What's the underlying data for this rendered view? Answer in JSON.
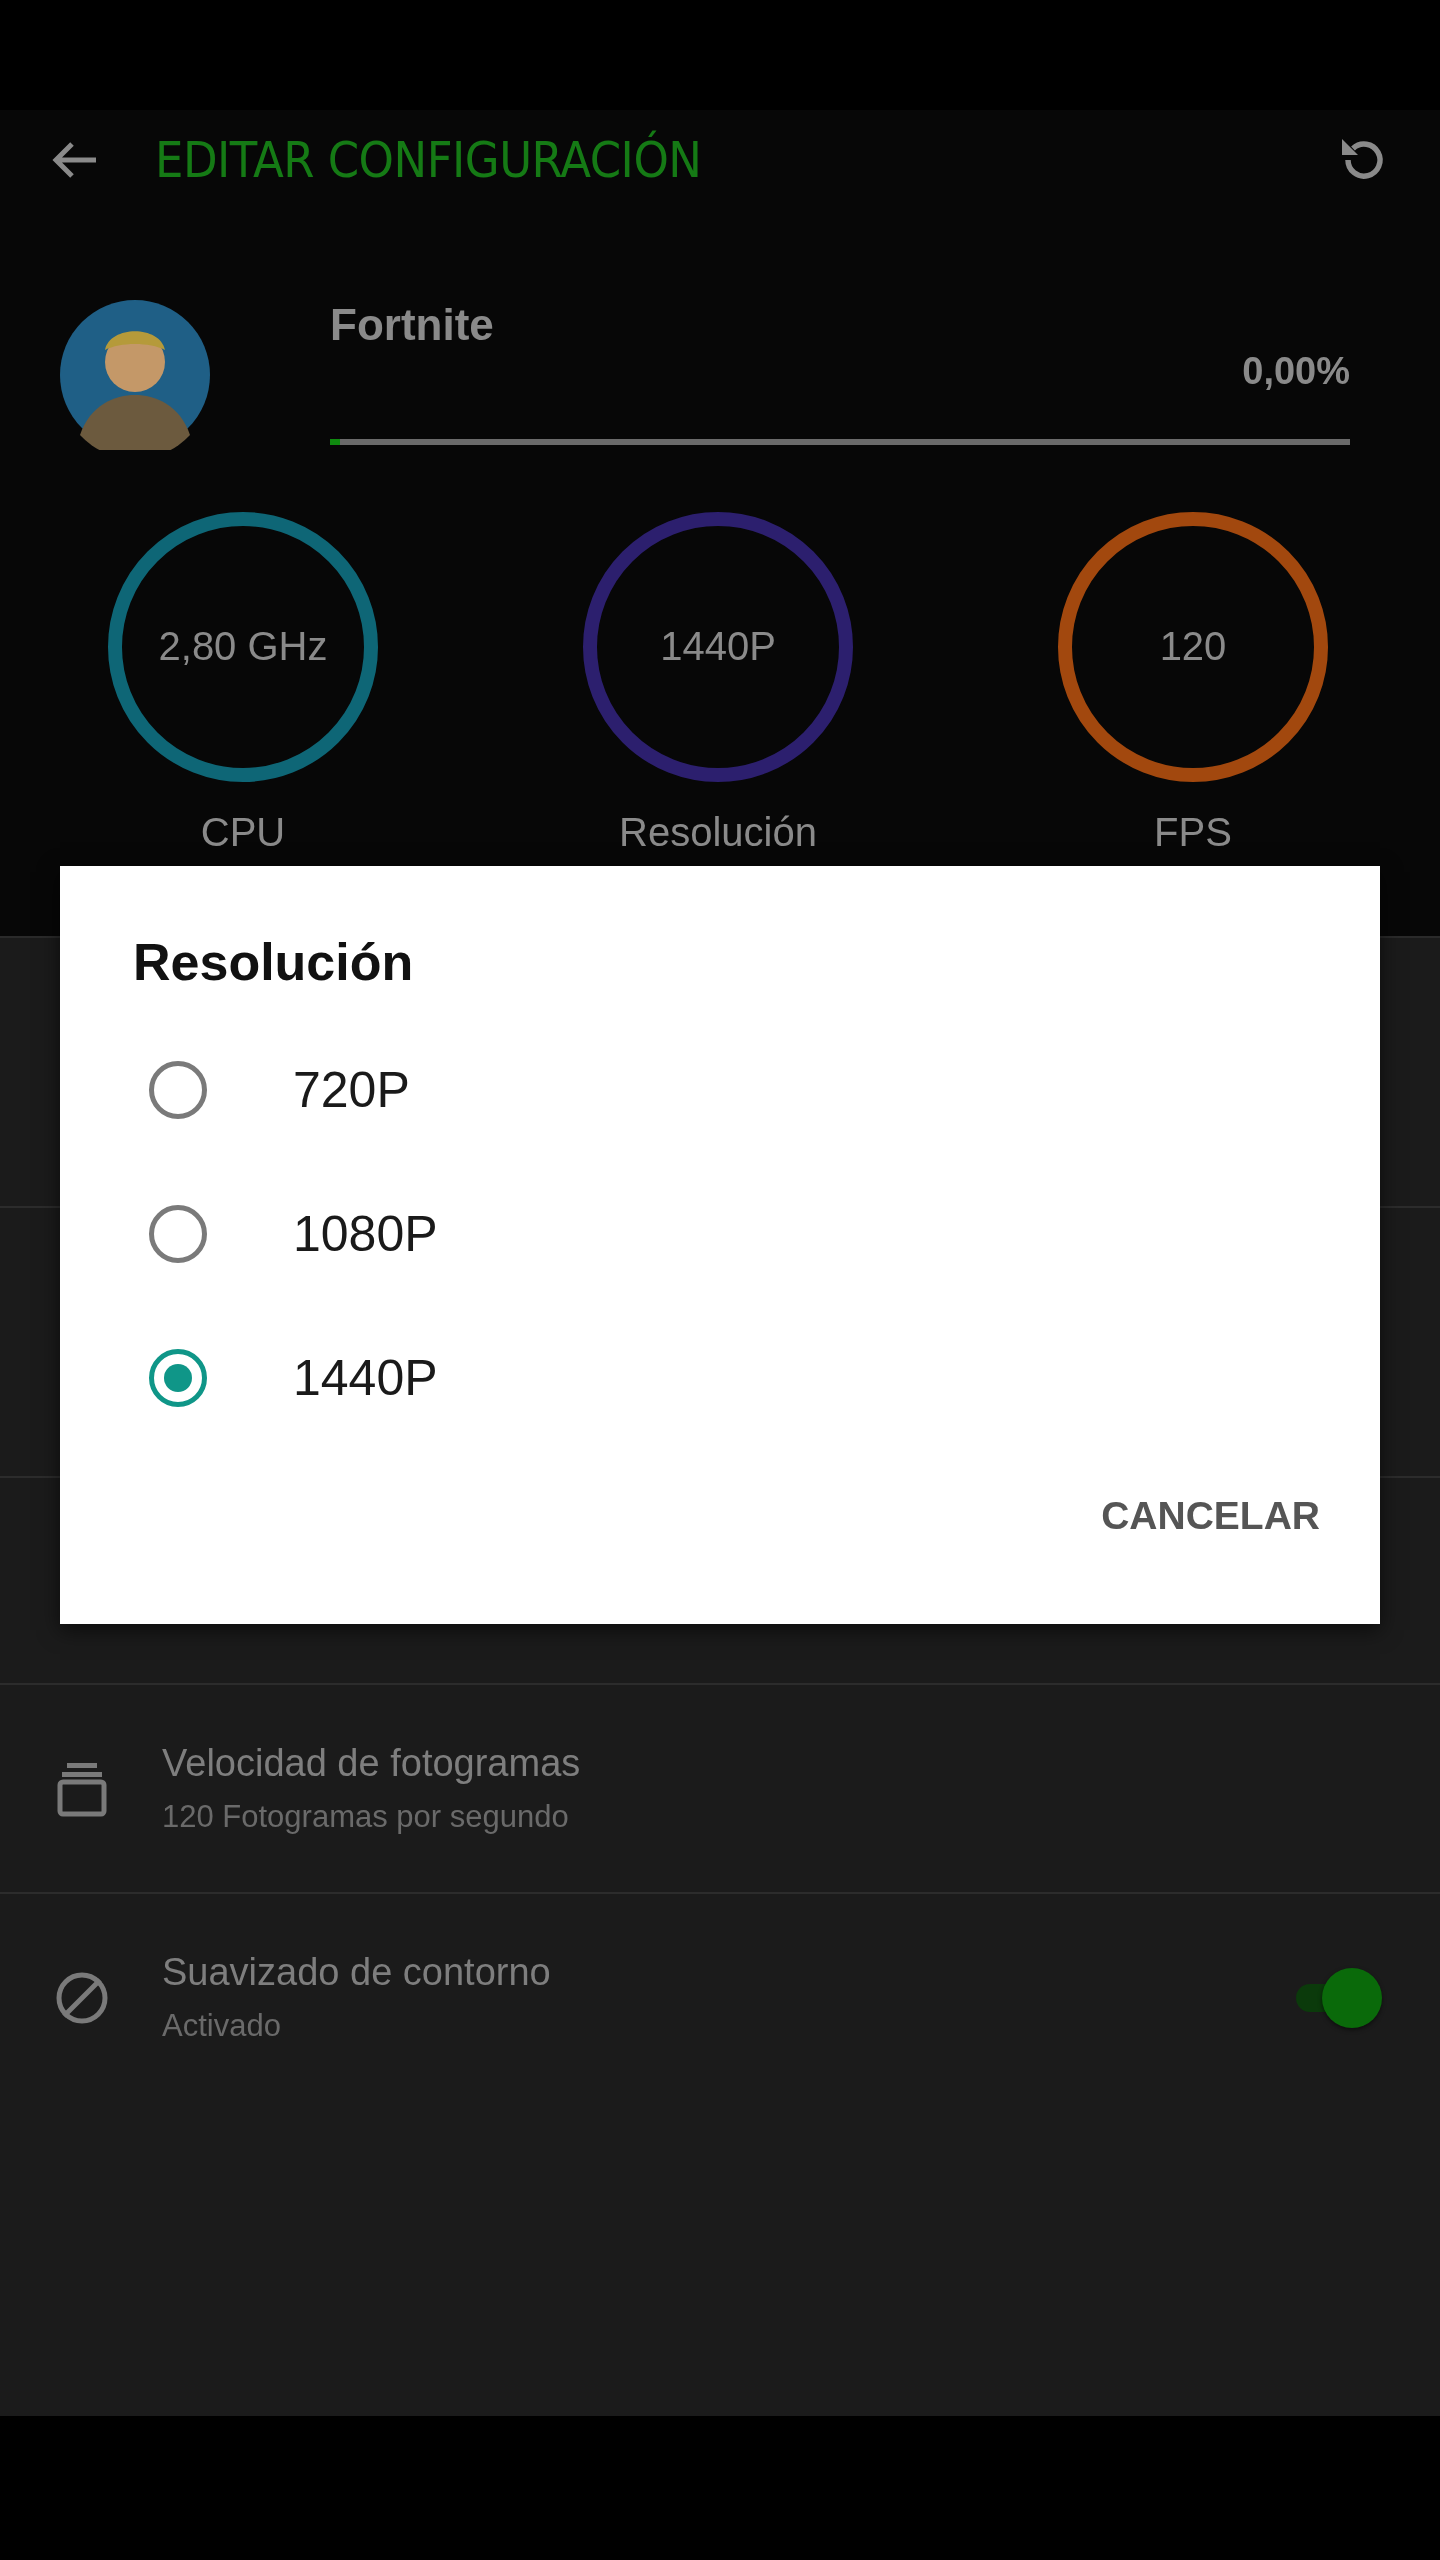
{
  "app_bar": {
    "title": "EDITAR CONFIGURACIÓN"
  },
  "game": {
    "name": "Fortnite",
    "progress": {
      "level": 0.01,
      "reading": "0,00%"
    }
  },
  "stats": [
    {
      "value": "2,80 GHz",
      "label": "CPU",
      "color": "#0e6676"
    },
    {
      "value": "1440P",
      "label": "Resolución",
      "color": "#2c1f6e"
    },
    {
      "value": "120",
      "label": "FPS",
      "color": "#a2480e"
    }
  ],
  "settings": [
    {
      "kind": "plain",
      "title": "Velocidad de fotogramas",
      "subtitle": "120 Fotogramas por segundo"
    },
    {
      "kind": "toggle",
      "title": "Suavizado de contorno",
      "subtitle": "Activado",
      "on": true
    }
  ],
  "dialog": {
    "title": "Resolución",
    "options": [
      {
        "label": "720P",
        "selected": false
      },
      {
        "label": "1080P",
        "selected": false
      },
      {
        "label": "1440P",
        "selected": true
      }
    ],
    "buttons": [
      "CANCELAR"
    ]
  }
}
